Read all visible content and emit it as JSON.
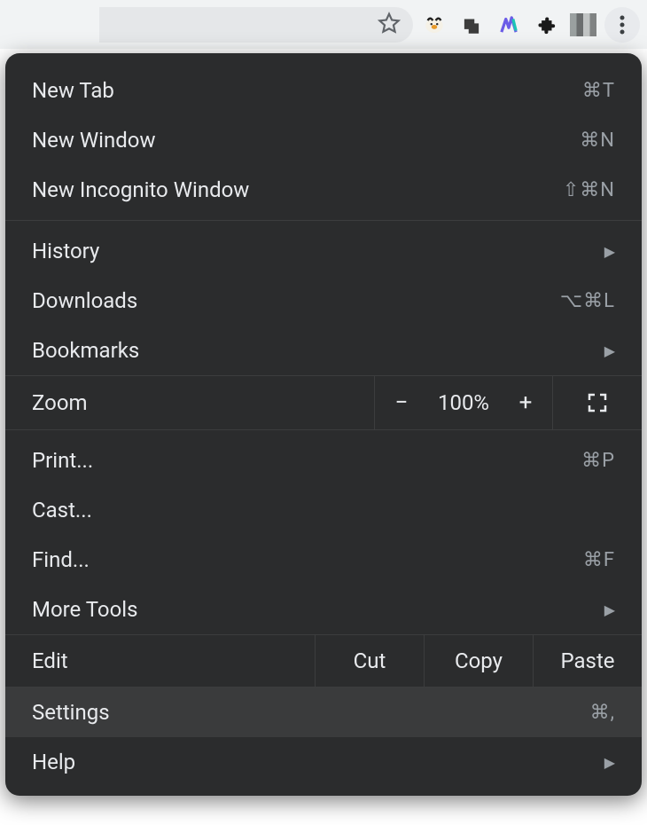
{
  "toolbar": {
    "icons": [
      "star-icon",
      "badger-icon",
      "tabs-icon",
      "monitor-icon",
      "puzzle-icon",
      "profile-icon",
      "kebab-icon"
    ]
  },
  "menu": {
    "new_tab": {
      "label": "New Tab",
      "shortcut": "⌘T"
    },
    "new_window": {
      "label": "New Window",
      "shortcut": "⌘N"
    },
    "new_incognito": {
      "label": "New Incognito Window",
      "shortcut": "⇧⌘N"
    },
    "history": {
      "label": "History",
      "submenu": true
    },
    "downloads": {
      "label": "Downloads",
      "shortcut": "⌥⌘L"
    },
    "bookmarks": {
      "label": "Bookmarks",
      "submenu": true
    },
    "zoom": {
      "label": "Zoom",
      "value": "100%",
      "minus": "−",
      "plus": "+"
    },
    "print": {
      "label": "Print...",
      "shortcut": "⌘P"
    },
    "cast": {
      "label": "Cast..."
    },
    "find": {
      "label": "Find...",
      "shortcut": "⌘F"
    },
    "more_tools": {
      "label": "More Tools",
      "submenu": true
    },
    "edit": {
      "label": "Edit",
      "cut": "Cut",
      "copy": "Copy",
      "paste": "Paste"
    },
    "settings": {
      "label": "Settings",
      "shortcut": "⌘,"
    },
    "help": {
      "label": "Help",
      "submenu": true
    }
  }
}
